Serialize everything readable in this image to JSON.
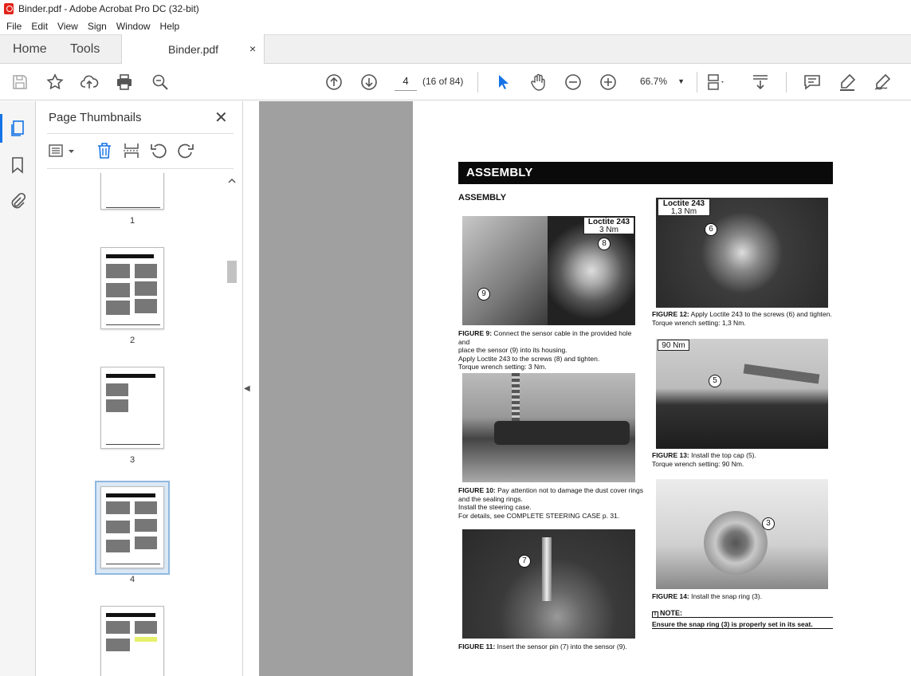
{
  "window": {
    "title": "Binder.pdf - Adobe Acrobat Pro DC (32-bit)"
  },
  "menu": [
    "File",
    "Edit",
    "View",
    "Sign",
    "Window",
    "Help"
  ],
  "tabs": {
    "home": "Home",
    "tools": "Tools",
    "document": "Binder.pdf",
    "close": "×"
  },
  "toolbar": {
    "page_number": "4",
    "page_count": "(16 of 84)",
    "zoom": "66.7%",
    "icons": [
      "save-icon",
      "star-icon",
      "upload-icon",
      "print-icon",
      "zoom-search-icon",
      "page-up-icon",
      "page-down-icon",
      "select-cursor-icon",
      "hand-icon",
      "zoom-out-icon",
      "zoom-in-icon",
      "page-display-icon",
      "scroll-mode-icon",
      "comment-icon",
      "highlight-icon",
      "sign-icon"
    ]
  },
  "sidebar": {
    "title": "Page Thumbnails",
    "close": "✕",
    "thumbnails": [
      {
        "label": "1"
      },
      {
        "label": "2"
      },
      {
        "label": "3"
      },
      {
        "label": "4",
        "selected": true
      },
      {
        "label": ""
      }
    ]
  },
  "document": {
    "banner": "ASSEMBLY",
    "subheading": "ASSEMBLY",
    "figures": [
      {
        "label_lines": [
          "Loctite 243",
          "3 Nm"
        ],
        "callouts": [
          "8",
          "9"
        ],
        "caption_bold": "FIGURE 9:",
        "caption_lines": [
          " Connect the sensor cable in the provided hole and",
          "place the sensor (9) into its housing.",
          "Apply Loctite 243 to the screws (8) and tighten.",
          "Torque wrench setting: 3 Nm."
        ]
      },
      {
        "label_lines": [],
        "callouts": [],
        "caption_bold": "FIGURE 10:",
        "caption_lines": [
          " Pay attention not to damage the dust cover rings",
          "and the sealing rings.",
          "Install the steering case.",
          "For details, see COMPLETE STEERING CASE p. 31."
        ]
      },
      {
        "label_lines": [],
        "callouts": [
          "7"
        ],
        "caption_bold": "FIGURE 11:",
        "caption_lines": [
          " Insert the sensor pin (7) into the sensor (9)."
        ]
      },
      {
        "label_lines": [
          "Loctite 243",
          "1,3 Nm"
        ],
        "callouts": [
          "6"
        ],
        "caption_bold": "FIGURE 12:",
        "caption_lines": [
          " Apply Loctite 243 to the screws (6) and tighten.",
          "Torque wrench setting: 1,3 Nm."
        ]
      },
      {
        "label_lines": [
          "90 Nm"
        ],
        "callouts": [
          "5"
        ],
        "caption_bold": "FIGURE 13:",
        "caption_lines": [
          " Install the top cap (5).",
          "Torque wrench setting: 90 Nm."
        ]
      },
      {
        "label_lines": [],
        "callouts": [
          "3"
        ],
        "caption_bold": "FIGURE 14:",
        "caption_lines": [
          " Install the snap ring (3)."
        ]
      }
    ],
    "note": {
      "title": "NOTE:",
      "text": "Ensure the snap ring (3) is properly set in its seat."
    }
  }
}
